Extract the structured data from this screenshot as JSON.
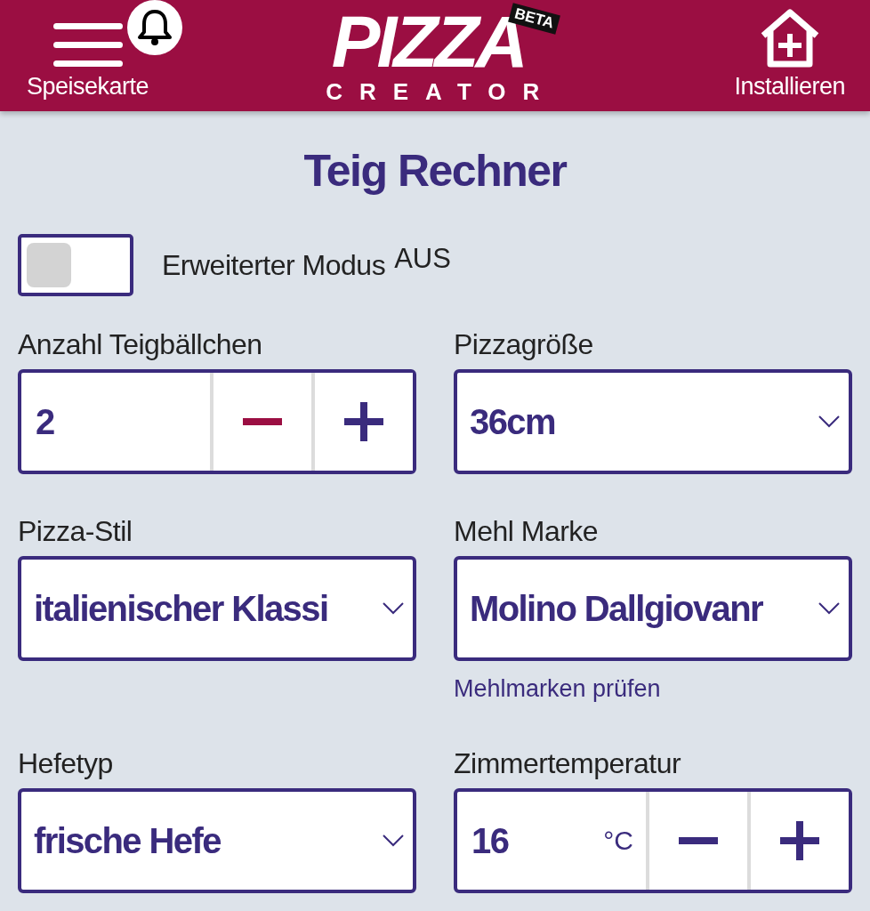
{
  "header": {
    "menu_label": "Speisekarte",
    "notification": true,
    "logo_main": "PIZZA",
    "logo_sub": "CREATOR",
    "logo_badge": "BETA",
    "install_label": "Installieren"
  },
  "title": "Teig Rechner",
  "advanced_mode": {
    "on": false,
    "label": "Erweiterter Modus",
    "state_text": "AUS"
  },
  "fields": [
    {
      "kind": "stepper",
      "label": "Anzahl Teigbällchen",
      "value": "2",
      "decrement_highlighted": true
    },
    {
      "kind": "select",
      "label": "Pizzagröße",
      "value": "36cm"
    },
    {
      "kind": "select",
      "label": "Pizza-Stil",
      "value": "italienischer Klassi"
    },
    {
      "kind": "select",
      "label": "Mehl Marke",
      "value": "Molino Dallgiovanr",
      "link": "Mehlmarken prüfen"
    },
    {
      "kind": "select",
      "label": "Hefetyp",
      "value": "frische Hefe"
    },
    {
      "kind": "stepper",
      "label": "Zimmertemperatur",
      "value": "16",
      "unit": "°C",
      "decrement_highlighted": false
    }
  ]
}
